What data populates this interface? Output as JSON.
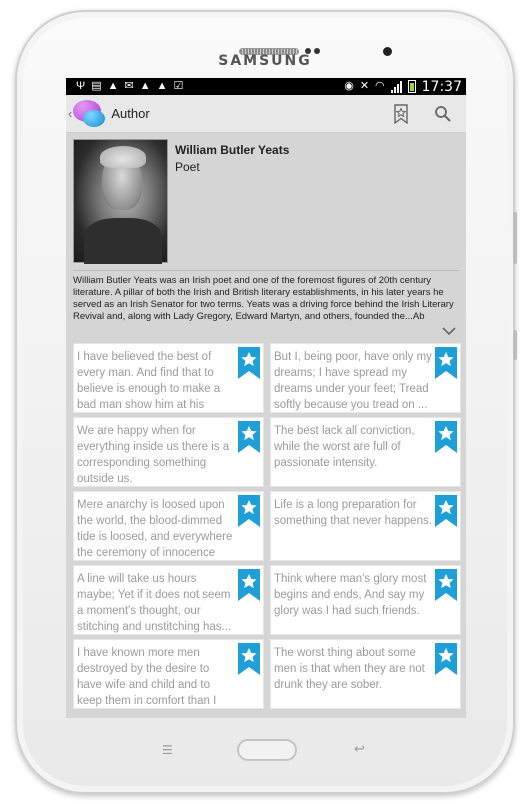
{
  "device": {
    "brand": "SAMSUNG"
  },
  "statusbar": {
    "time": "17:37"
  },
  "actionbar": {
    "title": "Author",
    "back": "‹"
  },
  "author": {
    "name": "William Butler Yeats",
    "role": "Poet",
    "bio": "William Butler Yeats was an Irish poet and one of the foremost figures of 20th century literature. A pillar of both the Irish and British literary establishments, in his later years he served as an Irish Senator for two terms. Yeats was a driving force behind the Irish Literary Revival and, along with Lady Gregory, Edward Martyn, and others, founded the...Ab"
  },
  "quotes": [
    "I have believed the best of every man. And find that to believe is enough to make a bad man show him at his bes...",
    "But I, being poor, have only my dreams; I have spread my dreams under your feet; Tread softly because you tread on ...",
    "We are happy when for everything inside us there is a corresponding something outside us.",
    "The best lack all conviction, while the worst are full of passionate intensity.",
    "Mere anarchy is loosed upon the world, the blood-dimmed tide is loosed, and everywhere the ceremony of innocence is...",
    "Life is a long preparation for something that never happens.",
    "A line will take us hours maybe; Yet if it does not seem a moment's thought, our stitching and unstitching has...",
    "Think where man's glory most begins and ends, And say my glory was I had such friends.",
    "I have known more men destroyed by the desire to have wife and child and to keep them in comfort than I have...",
    "The worst thing about some men is that when they are not drunk they are sober."
  ],
  "colors": {
    "bookmark": "#1e9fd8",
    "quote_text": "#9b9b9b",
    "screen_bg": "#d5d5d5"
  }
}
